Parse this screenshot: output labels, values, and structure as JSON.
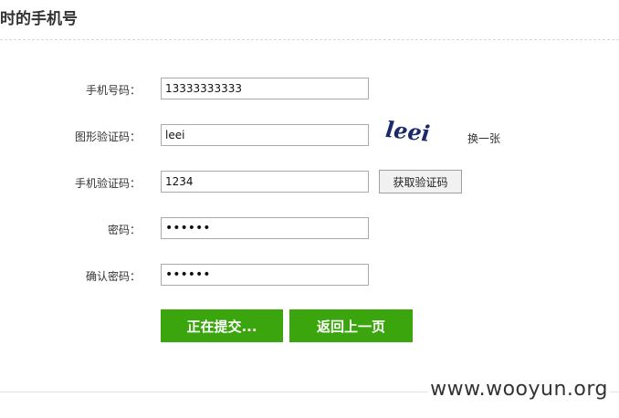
{
  "header": {
    "title": "时的手机号"
  },
  "form": {
    "phone": {
      "label": "手机号码：",
      "value": "13333333333"
    },
    "captcha": {
      "label": "图形验证码：",
      "value": "leei",
      "image_text": "leei",
      "refresh_label": "换一张"
    },
    "sms_code": {
      "label": "手机验证码：",
      "value": "1234",
      "button_label": "获取验证码"
    },
    "password": {
      "label": "密码：",
      "value": "••••••"
    },
    "confirm_password": {
      "label": "确认密码：",
      "value": "••••••"
    }
  },
  "actions": {
    "submit_label": "正在提交...",
    "back_label": "返回上一页"
  },
  "watermark": {
    "text": "www.wooyun.org"
  },
  "colors": {
    "primary_button": "#3aa50c",
    "captcha_ink": "#1a2a6c"
  }
}
